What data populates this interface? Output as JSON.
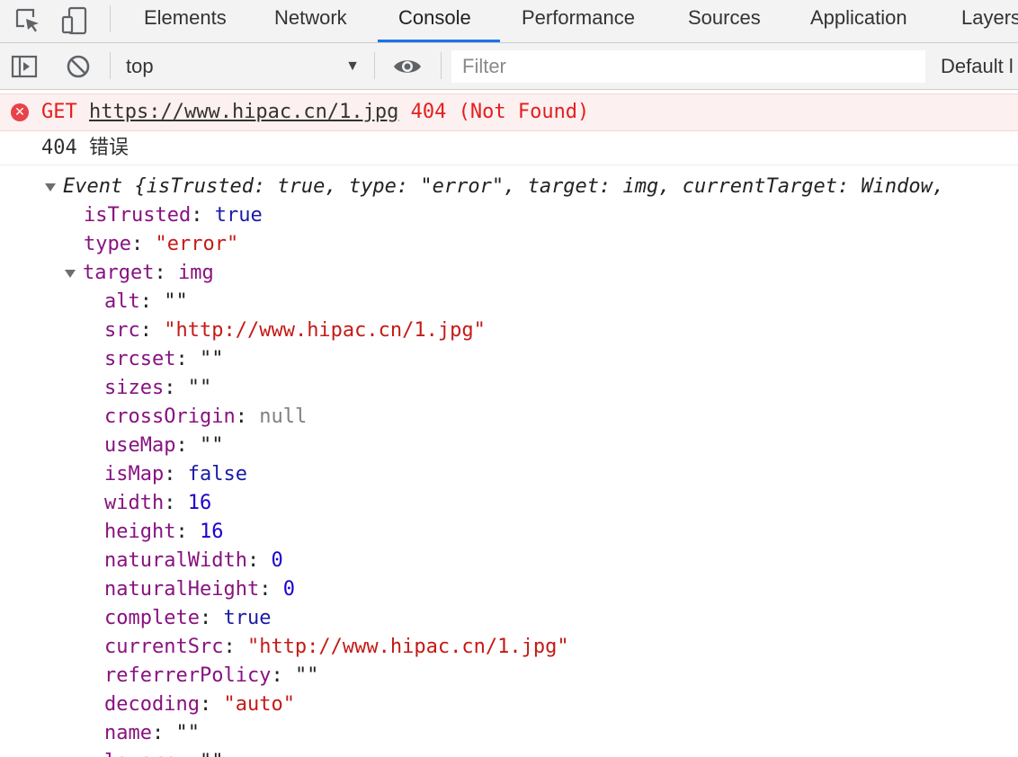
{
  "tabs": {
    "elements": "Elements",
    "network": "Network",
    "console": "Console",
    "performance": "Performance",
    "sources": "Sources",
    "application": "Application",
    "layers": "Layers"
  },
  "toolbar": {
    "context": "top",
    "filter_placeholder": "Filter",
    "levels": "Default l"
  },
  "error": {
    "method": "GET",
    "url": "https://www.hipac.cn/1.jpg",
    "status": "404 (Not Found)"
  },
  "log": {
    "text": "404 错误"
  },
  "event": {
    "summary_label": "Event",
    "summary_preview": "{isTrusted: true, type: \"error\", target: img, currentTarget: Window,",
    "props": [
      {
        "key": "isTrusted",
        "value": "true"
      },
      {
        "key": "type",
        "value": "\"error\""
      }
    ],
    "target": {
      "key": "target",
      "value": "img",
      "props": [
        {
          "key": "alt",
          "value": "\"\""
        },
        {
          "key": "src",
          "value": "\"http://www.hipac.cn/1.jpg\""
        },
        {
          "key": "srcset",
          "value": "\"\""
        },
        {
          "key": "sizes",
          "value": "\"\""
        },
        {
          "key": "crossOrigin",
          "value": "null"
        },
        {
          "key": "useMap",
          "value": "\"\""
        },
        {
          "key": "isMap",
          "value": "false"
        },
        {
          "key": "width",
          "value": "16"
        },
        {
          "key": "height",
          "value": "16"
        },
        {
          "key": "naturalWidth",
          "value": "0"
        },
        {
          "key": "naturalHeight",
          "value": "0"
        },
        {
          "key": "complete",
          "value": "true"
        },
        {
          "key": "currentSrc",
          "value": "\"http://www.hipac.cn/1.jpg\""
        },
        {
          "key": "referrerPolicy",
          "value": "\"\""
        },
        {
          "key": "decoding",
          "value": "\"auto\""
        },
        {
          "key": "name",
          "value": "\"\""
        },
        {
          "key": "lowsrc",
          "value": "\"\""
        }
      ]
    }
  }
}
